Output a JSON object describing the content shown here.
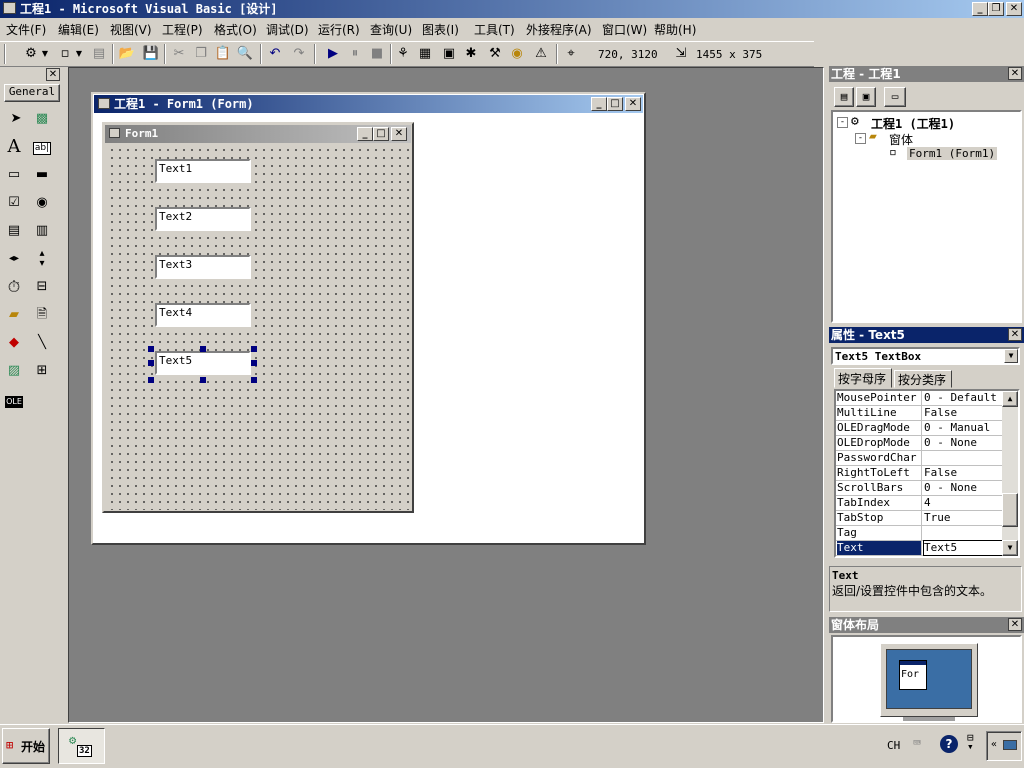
{
  "app": {
    "title": "工程1 - Microsoft Visual Basic [设计]",
    "menu": [
      "文件(F)",
      "编辑(E)",
      "视图(V)",
      "工程(P)",
      "格式(O)",
      "调试(D)",
      "运行(R)",
      "查询(U)",
      "图表(I)",
      "工具(T)",
      "外接程序(A)",
      "窗口(W)",
      "帮助(H)"
    ],
    "toolbar": {
      "position": "720, 3120",
      "size": "1455 x 375"
    },
    "window_buttons": {
      "minimize": "_",
      "restore": "❐",
      "close": "✕"
    }
  },
  "toolbox": {
    "header": "General",
    "tools": [
      "pointer",
      "picturebox",
      "label",
      "textbox",
      "frame",
      "commandbutton",
      "checkbox",
      "optionbutton",
      "combobox",
      "listbox",
      "hscrollbar",
      "vscrollbar",
      "timer",
      "drivelistbox",
      "dirlistbox",
      "filelistbox",
      "shape",
      "line",
      "image",
      "data",
      "ole"
    ],
    "ole_label": "OLE",
    "textbox_label": "ab|"
  },
  "designer": {
    "title": "工程1 - Form1 (Form)",
    "form_title": "Form1",
    "textboxes": [
      "Text1",
      "Text2",
      "Text3",
      "Text4",
      "Text5"
    ]
  },
  "project": {
    "title": "工程 - 工程1",
    "root": "工程1 (工程1)",
    "folder": "窗体",
    "form": "Form1 (Form1)"
  },
  "properties": {
    "title": "属性 - Text5",
    "object": "Text5 TextBox",
    "tabs": [
      "按字母序",
      "按分类序"
    ],
    "rows": [
      {
        "name": "MousePointer",
        "value": "0 - Default"
      },
      {
        "name": "MultiLine",
        "value": "False"
      },
      {
        "name": "OLEDragMode",
        "value": "0 - Manual"
      },
      {
        "name": "OLEDropMode",
        "value": "0 - None"
      },
      {
        "name": "PasswordChar",
        "value": ""
      },
      {
        "name": "RightToLeft",
        "value": "False"
      },
      {
        "name": "ScrollBars",
        "value": "0 - None"
      },
      {
        "name": "TabIndex",
        "value": "4"
      },
      {
        "name": "TabStop",
        "value": "True"
      },
      {
        "name": "Tag",
        "value": ""
      },
      {
        "name": "Text",
        "value": "Text5"
      }
    ],
    "desc_title": "Text",
    "desc_text": "返回/设置控件中包含的文本。"
  },
  "layout": {
    "title": "窗体布局",
    "preview_label": "For"
  },
  "taskbar": {
    "start": "开始",
    "lang": "CH",
    "vb_badge": "32"
  },
  "colors": {
    "active_title": "#0a246a",
    "inactive_title": "#808080",
    "workspace": "#808080",
    "face": "#d4d0c8",
    "selection": "#000080",
    "monitor_screen": "#3a6ea5"
  }
}
